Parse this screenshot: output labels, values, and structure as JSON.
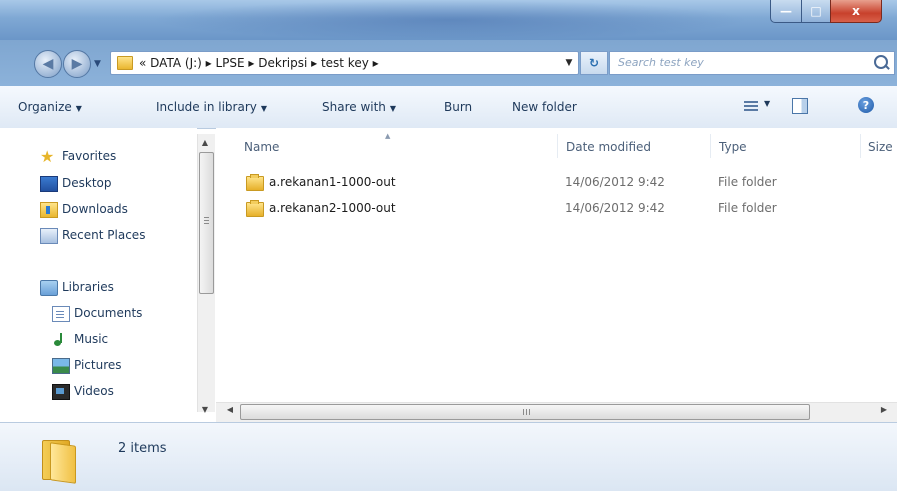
{
  "window": {
    "minimize_glyph": "—",
    "maximize_glyph": "□",
    "close_glyph": "x",
    "colors": {
      "titlebar": "#7fa8d4",
      "close": "#c8412c"
    }
  },
  "nav": {
    "back_glyph": "◀",
    "forward_glyph": "▶",
    "breadcrumb": "« DATA (J:)  ▸  LPSE  ▸  Dekripsi  ▸  test key  ▸",
    "refresh_glyph": "↻",
    "search_placeholder": "Search test key"
  },
  "toolbar": {
    "organize": "Organize",
    "include_in_library": "Include in library",
    "share_with": "Share with",
    "burn": "Burn",
    "new_folder": "New folder",
    "help_glyph": "?"
  },
  "sidebar": {
    "favorites": "Favorites",
    "desktop": "Desktop",
    "downloads": "Downloads",
    "recent_places": "Recent Places",
    "libraries": "Libraries",
    "documents": "Documents",
    "music": "Music",
    "pictures": "Pictures",
    "videos": "Videos"
  },
  "columns": {
    "name": "Name",
    "date_modified": "Date modified",
    "type": "Type",
    "size": "Size"
  },
  "files": [
    {
      "name": "a.rekanan1-1000-out",
      "date": "14/06/2012 9:42",
      "type": "File folder"
    },
    {
      "name": "a.rekanan2-1000-out",
      "date": "14/06/2012 9:42",
      "type": "File folder"
    }
  ],
  "details": {
    "item_count": "2 items"
  }
}
